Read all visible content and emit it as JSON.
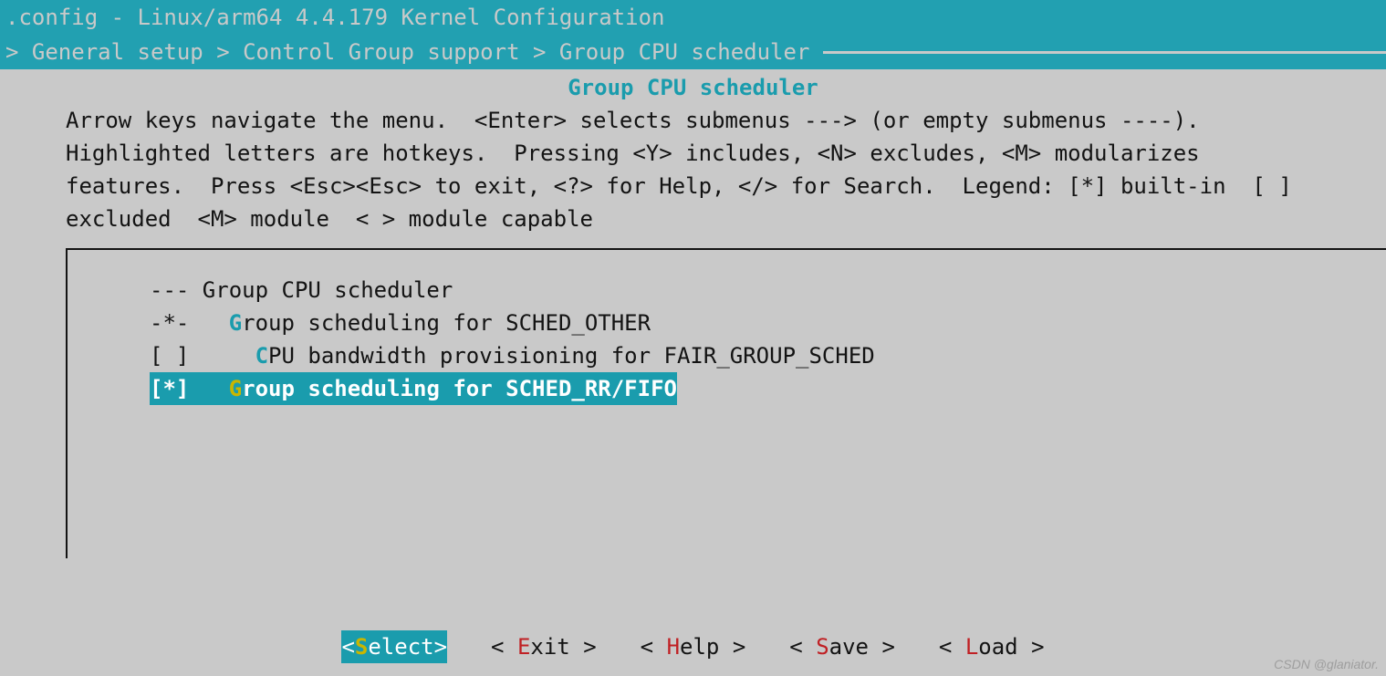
{
  "title": ".config - Linux/arm64 4.4.179 Kernel Configuration",
  "breadcrumb": {
    "prefix": "> ",
    "parts": [
      "General setup",
      "Control Group support",
      "Group CPU scheduler"
    ],
    "sep": " > "
  },
  "panel_title": "Group CPU scheduler",
  "help_text": "Arrow keys navigate the menu.  <Enter> selects submenus ---> (or empty submenus ----).  Highlighted letters are hotkeys.  Pressing <Y> includes, <N> excludes, <M> modularizes features.  Press <Esc><Esc> to exit, <?> for Help, </> for Search.  Legend: [*] built-in  [ ] excluded  <M> module  < > module capable",
  "menu": {
    "items": [
      {
        "mark": "---",
        "indent": " ",
        "label": "Group CPU scheduler",
        "hot": "",
        "selected": false
      },
      {
        "mark": "-*-",
        "indent": "   ",
        "label": "roup scheduling for SCHED_OTHER",
        "hot": "G",
        "selected": false
      },
      {
        "mark": "[ ]",
        "indent": "     ",
        "label": "PU bandwidth provisioning for FAIR_GROUP_SCHED",
        "hot": "C",
        "selected": false
      },
      {
        "mark": "[*]",
        "indent": "   ",
        "label": "roup scheduling for SCHED_RR/FIFO",
        "hot": "G",
        "selected": true
      }
    ]
  },
  "buttons": [
    {
      "label": "elect",
      "hot": "S",
      "selected": true
    },
    {
      "label": "xit",
      "hot": "E",
      "selected": false
    },
    {
      "label": "elp",
      "hot": "H",
      "selected": false
    },
    {
      "label": "ave",
      "hot": "S",
      "selected": false
    },
    {
      "label": "oad",
      "hot": "L",
      "selected": false
    }
  ],
  "watermark": "CSDN @glaniator."
}
